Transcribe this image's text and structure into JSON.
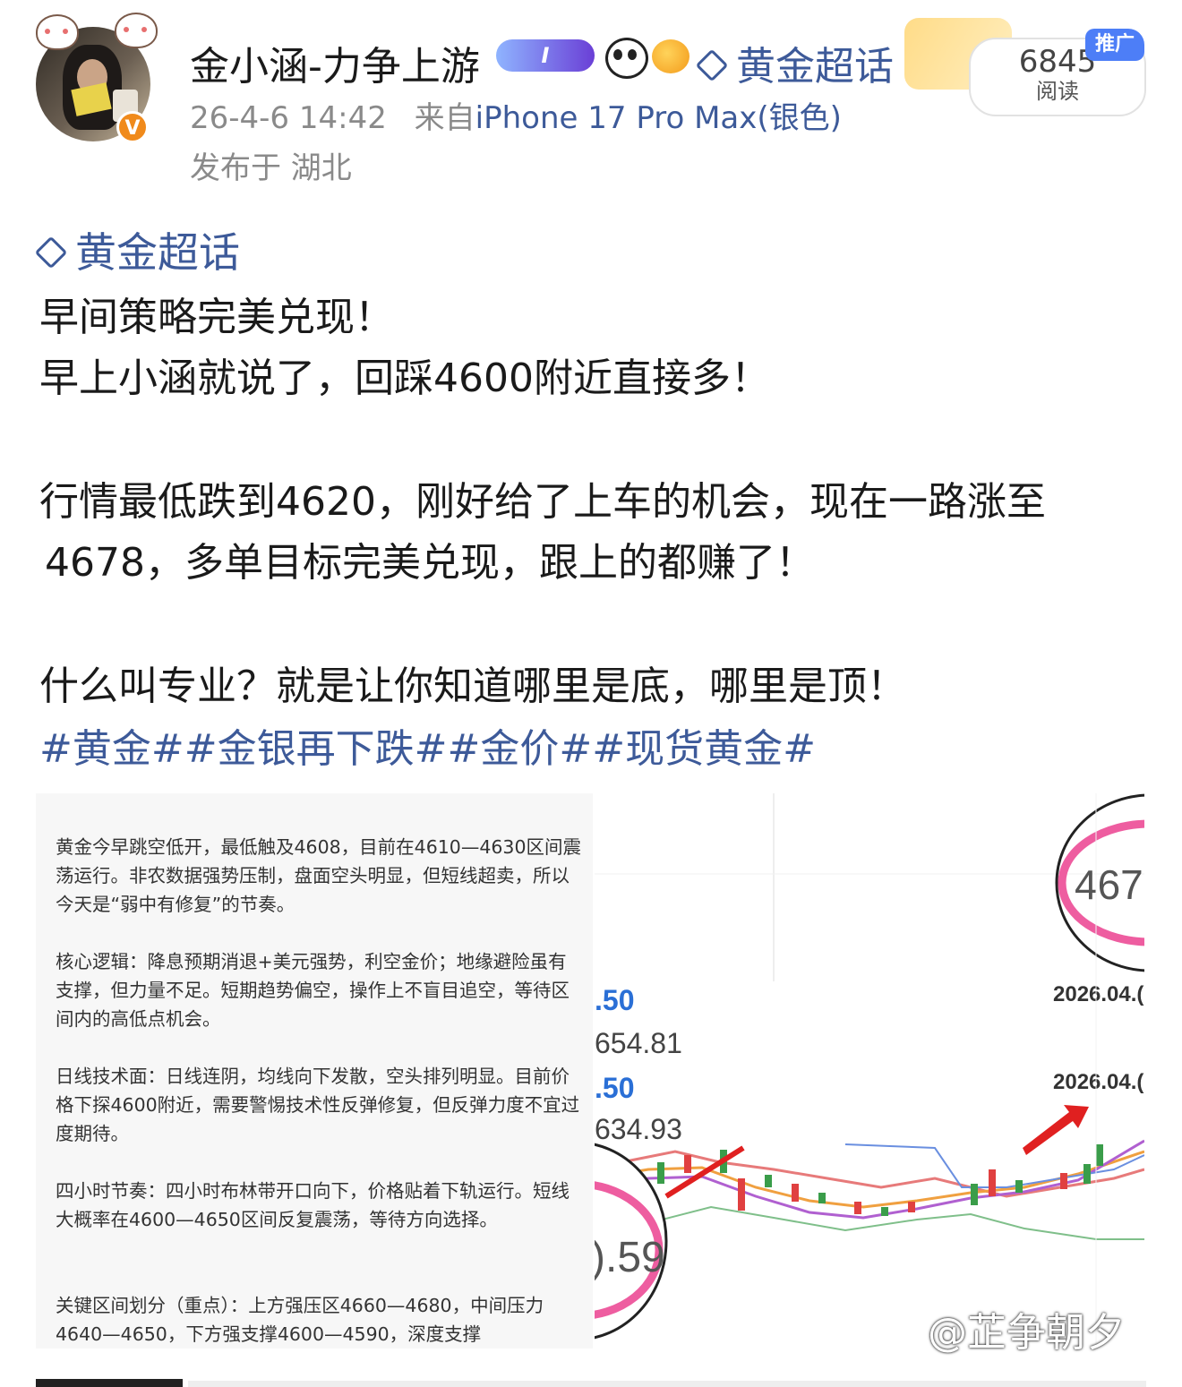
{
  "user": {
    "name": "金小涵-力争上游",
    "level_badge": "I",
    "verified_mark": "V",
    "topic": "黄金超话"
  },
  "post_meta": {
    "time": "26-4-6 14:42",
    "source_prefix": "来自",
    "device": "iPhone 17 Pro Max(银色)",
    "location": "发布于 湖北"
  },
  "promo_label": "推广",
  "reads": {
    "count": "6845",
    "label": "阅读"
  },
  "content": {
    "topic_link": "黄金超话",
    "lines": [
      "早间策略完美兑现！",
      "早上小涵就说了，回踩4600附近直接多！",
      "行情最低跌到4620，刚好给了上车的机会，现在一路涨至",
      "4678，多单目标完美兑现，跟上的都赚了！",
      "什么叫专业？就是让你知道哪里是底，哪里是顶！"
    ],
    "hashtags": "#黄金##金银再下跌##金价##现货黄金#"
  },
  "image_text": {
    "paragraphs": [
      "黄金今早跳空低开，最低触及4608，目前在4610—4630区间震荡运行。非农数据强势压制，盘面空头明显，但短线超卖，所以今天是“弱中有修复”的节奏。",
      "核心逻辑：降息预期消退+美元强势，利空金价；地缘避险虽有支撑，但力量不足。短期趋势偏空，操作上不盲目追空，等待区间内的高低点机会。",
      "日线技术面：日线连阴，均线向下发散，空头排列明显。目前价格下探4600附近，需要警惕技术性反弹修复，但反弹力度不宜过度期待。",
      "四小时节奏：四小时布林带开口向下，价格贴着下轨运行。短线大概率在4600—4650区间反复震荡，等待方向选择。",
      "关键区间划分（重点）：上方强压区4660—4680，中间压力4640—4650，下方强支撑4600—4590，深度支撑"
    ]
  },
  "chart_crop": {
    "circle_top": "467",
    "date_1": "2026.04.(",
    "date_2": "2026.04.(",
    "val_a": ".50",
    "val_b": "654.81",
    "val_c": ".50",
    "val_d": "634.93",
    "circle_bottom": ").59"
  },
  "watermark": "@芷争朝夕",
  "colors": {
    "link": "#3d5a99",
    "meta": "#8a8a8a",
    "accent_orange": "#f08a1b",
    "promo_blue": "#4d7ef7"
  }
}
